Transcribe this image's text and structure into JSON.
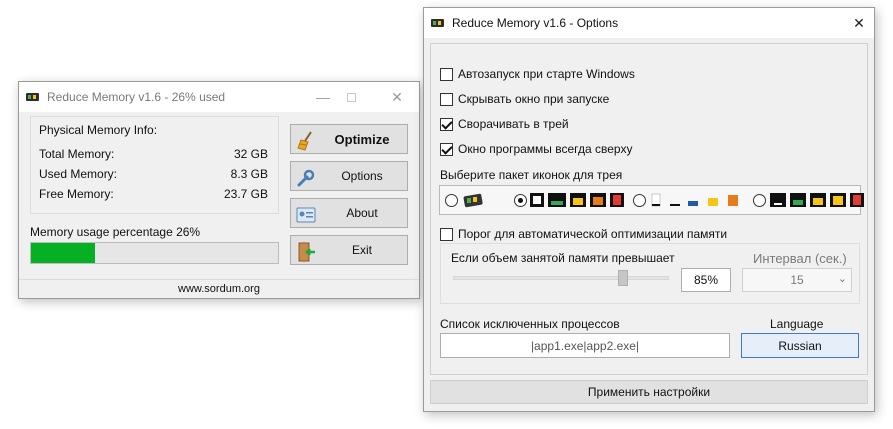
{
  "main_window": {
    "title": "Reduce Memory v1.6 - 26% used",
    "info_group_title": "Physical Memory Info:",
    "rows": [
      {
        "label": "Total Memory:",
        "value": "32 GB"
      },
      {
        "label": "Used Memory:",
        "value": "8.3 GB"
      },
      {
        "label": "Free Memory:",
        "value": "23.7 GB"
      }
    ],
    "usage_label": "Memory usage percentage 26%",
    "usage_percent": 26,
    "buttons": {
      "optimize": "Optimize",
      "options": "Options",
      "about": "About",
      "exit": "Exit"
    },
    "footer_link": "www.sordum.org"
  },
  "options_window": {
    "title": "Reduce Memory v1.6 - Options",
    "checkboxes": [
      {
        "label": "Автозапуск при старте Windows",
        "checked": false
      },
      {
        "label": "Скрывать окно при запуске",
        "checked": false
      },
      {
        "label": "Сворачивать в трей",
        "checked": true
      },
      {
        "label": "Окно программы всегда сверху",
        "checked": true
      }
    ],
    "icon_pack_label": "Выберите пакет иконок для трея",
    "icon_pack_selected": 1,
    "auto_optimize": {
      "label": "Порог для автоматической оптимизации памяти",
      "checked": false
    },
    "threshold_label": "Если объем занятой памяти превышает",
    "threshold_value": "85%",
    "interval_label": "Интервал (сек.)",
    "interval_value": "15",
    "exclusion_label": "Список исключенных процессов",
    "exclusion_value": "|app1.exe|app2.exe|",
    "language_label": "Language",
    "language_value": "Russian",
    "apply_button": "Применить настройки"
  }
}
